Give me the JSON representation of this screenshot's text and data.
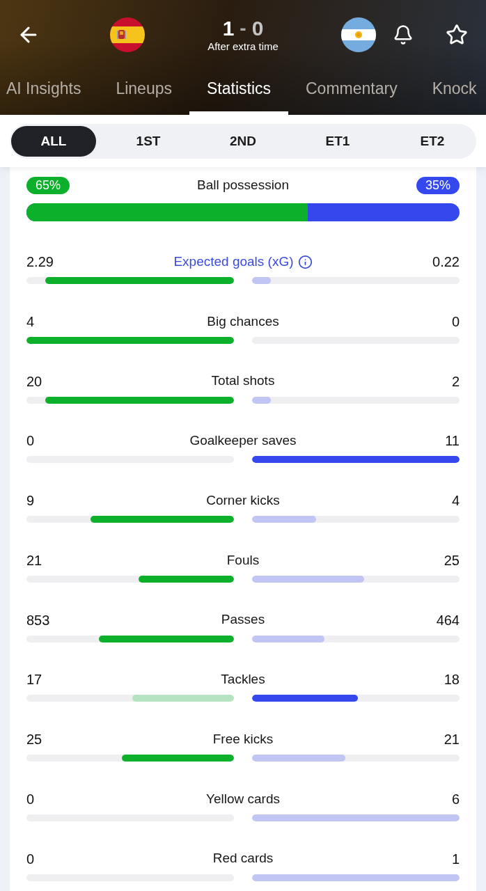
{
  "match": {
    "score": [
      {
        "value": "1",
        "leading": true
      },
      {
        "value": "0",
        "leading": false
      }
    ],
    "separator": "-",
    "status": "After extra time"
  },
  "tabs": [
    {
      "label": "AI Insights",
      "selected": false
    },
    {
      "label": "Lineups",
      "selected": false
    },
    {
      "label": "Statistics",
      "selected": true
    },
    {
      "label": "Commentary",
      "selected": false
    },
    {
      "label": "Knock",
      "selected": false
    }
  ],
  "periods": [
    {
      "label": "ALL",
      "selected": true
    },
    {
      "label": "1ST",
      "selected": false
    },
    {
      "label": "2ND",
      "selected": false
    },
    {
      "label": "ET1",
      "selected": false
    },
    {
      "label": "ET2",
      "selected": false
    }
  ],
  "possession": {
    "label": "Ball possession",
    "home": "65%",
    "away": "35%",
    "level": 0.65
  },
  "stats": [
    {
      "label": "Expected goals (xG)",
      "kind": "link",
      "home": {
        "value": "2.29",
        "level": 0.91,
        "leading": true
      },
      "away": {
        "value": "0.22",
        "level": 0.09,
        "leading": false
      }
    },
    {
      "label": "Big chances",
      "kind": "plain",
      "home": {
        "value": "4",
        "level": 1,
        "leading": true
      },
      "away": {
        "value": "0"
      }
    },
    {
      "label": "Total shots",
      "kind": "plain",
      "home": {
        "value": "20",
        "level": 0.91,
        "leading": true
      },
      "away": {
        "value": "2",
        "level": 0.09,
        "leading": false
      }
    },
    {
      "label": "Goalkeeper saves",
      "kind": "plain",
      "home": {
        "value": "0"
      },
      "away": {
        "value": "11",
        "level": 1,
        "leading": true
      }
    },
    {
      "label": "Corner kicks",
      "kind": "plain",
      "home": {
        "value": "9",
        "level": 0.69,
        "leading": true
      },
      "away": {
        "value": "4",
        "level": 0.31,
        "leading": false
      }
    },
    {
      "label": "Fouls",
      "kind": "plain",
      "home": {
        "value": "21",
        "level": 0.46,
        "leading": true
      },
      "away": {
        "value": "25",
        "level": 0.54,
        "leading": false
      }
    },
    {
      "label": "Passes",
      "kind": "plain",
      "home": {
        "value": "853",
        "level": 0.65,
        "leading": true
      },
      "away": {
        "value": "464",
        "level": 0.35,
        "leading": false
      }
    },
    {
      "label": "Tackles",
      "kind": "plain",
      "home": {
        "value": "17",
        "level": 0.49,
        "leading": false
      },
      "away": {
        "value": "18",
        "level": 0.51,
        "leading": true
      }
    },
    {
      "label": "Free kicks",
      "kind": "plain",
      "home": {
        "value": "25",
        "level": 0.54,
        "leading": true
      },
      "away": {
        "value": "21",
        "level": 0.45,
        "leading": false
      }
    },
    {
      "label": "Yellow cards",
      "kind": "plain",
      "home": {
        "value": "0"
      },
      "away": {
        "value": "6",
        "level": 1,
        "leading": false
      }
    },
    {
      "label": "Red cards",
      "kind": "plain",
      "home": {
        "value": "0"
      },
      "away": {
        "value": "1",
        "level": 1,
        "leading": false
      }
    }
  ]
}
